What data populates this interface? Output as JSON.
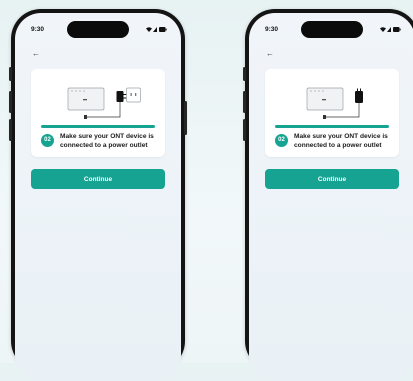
{
  "screens": [
    {
      "status": {
        "time": "9:30"
      },
      "step": {
        "number": "02",
        "text": "Make sure your ONT device is connected to a power outlet"
      },
      "continue_label": "Continue",
      "illustration": "ont-device-with-adapter-plugged-into-outlet"
    },
    {
      "status": {
        "time": "9:30"
      },
      "step": {
        "number": "02",
        "text": "Make sure your ONT device is connected to a power outlet"
      },
      "continue_label": "Continue",
      "illustration": "ont-device-with-power-adapter"
    }
  ],
  "colors": {
    "accent": "#17a391",
    "device_frame": "#141414",
    "background": "#eaf4f5"
  },
  "icons": [
    "back-arrow-icon",
    "wifi-icon",
    "signal-icon",
    "battery-icon"
  ]
}
